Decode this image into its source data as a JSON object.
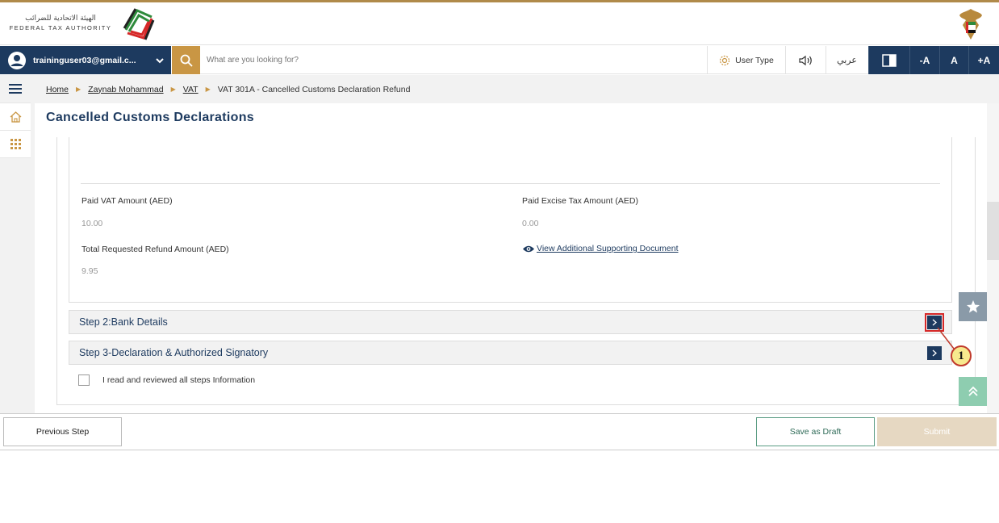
{
  "header": {
    "logo_ar": "الهيئة الاتحادية للضرائب",
    "logo_en": "FEDERAL TAX AUTHORITY"
  },
  "toolbar": {
    "user_email": "traininguser03@gmail.c...",
    "search_placeholder": "What are you looking for?",
    "user_type_label": "User Type",
    "arabic_label": "عربي",
    "font_decrease": "-A",
    "font_normal": "A",
    "font_increase": "+A"
  },
  "breadcrumb": {
    "home": "Home",
    "person": "Zaynab Mohammad",
    "vat": "VAT",
    "current": "VAT 301A - Cancelled Customs Declaration Refund"
  },
  "page": {
    "title": "Cancelled Customs Declarations"
  },
  "fields": {
    "paid_vat_label": "Paid VAT Amount (AED)",
    "paid_vat_value": "10.00",
    "paid_excise_label": "Paid Excise Tax Amount (AED)",
    "paid_excise_value": "0.00",
    "total_refund_label": "Total Requested Refund Amount (AED)",
    "total_refund_value": "9.95",
    "additional_doc_link": "View Additional Supporting Document"
  },
  "steps": [
    {
      "label": "Step 2:Bank Details"
    },
    {
      "label": "Step 3-Declaration & Authorized Signatory"
    }
  ],
  "confirm_checkbox_label": "I read and reviewed all steps Information",
  "callout_number": "1",
  "footer": {
    "previous_label": "Previous Step",
    "draft_label": "Save as Draft",
    "submit_label": "Submit"
  },
  "colors": {
    "primary_navy": "#1d3a5f",
    "accent_gold": "#c99644",
    "callout_red": "#d62828"
  }
}
